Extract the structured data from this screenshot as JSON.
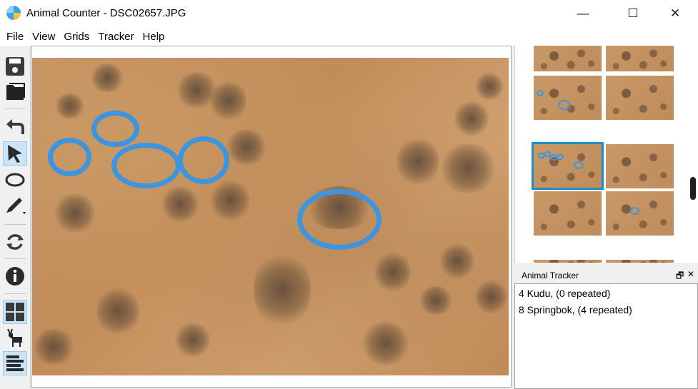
{
  "window": {
    "title": "Animal Counter - DSC02657.JPG",
    "minimize_symbol": "—",
    "maximize_symbol": "☐",
    "close_symbol": "✕"
  },
  "menu": [
    "File",
    "View",
    "Grids",
    "Tracker",
    "Help"
  ],
  "toolbar": {
    "tools": [
      {
        "name": "save-icon",
        "active": false
      },
      {
        "name": "folder-icon",
        "active": false
      },
      {
        "name": "undo-icon",
        "active": false
      },
      {
        "name": "pointer-icon",
        "active": true
      },
      {
        "name": "ellipse-icon",
        "active": false
      },
      {
        "name": "pen-icon",
        "active": false
      },
      {
        "name": "refresh-icon",
        "active": false
      },
      {
        "name": "info-icon",
        "active": false
      },
      {
        "name": "grid-icon",
        "active": true
      },
      {
        "name": "animal-icon",
        "active": false
      },
      {
        "name": "list-icon",
        "active": true
      }
    ]
  },
  "tracker": {
    "title": "Animal Tracker",
    "float_symbol": "🗗",
    "close_symbol": "✕",
    "entries": [
      "4 Kudu, (0 repeated)",
      "8 Springbok, (4 repeated)"
    ]
  },
  "colors": {
    "marker": "#3c95de",
    "selection": "#1a8fc9",
    "terrain": "#c79462"
  }
}
